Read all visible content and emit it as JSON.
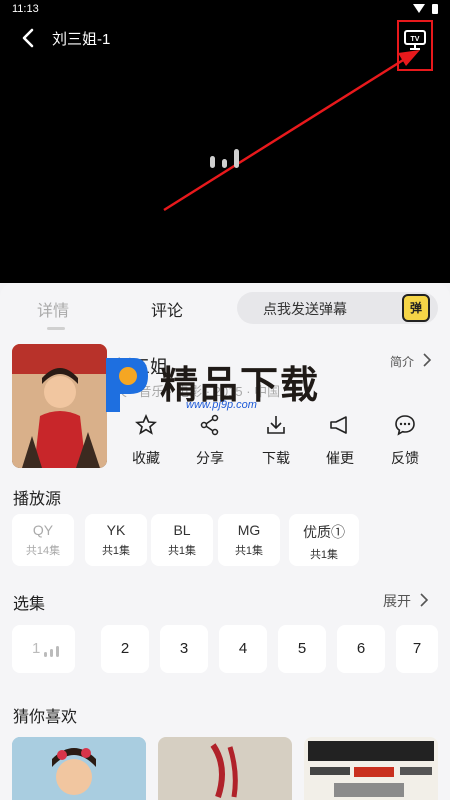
{
  "status_bar": {
    "time": "11:13"
  },
  "player": {
    "title": "刘三姐-1",
    "tv_icon_label": "TV"
  },
  "tabs": [
    {
      "label": "详情",
      "active": true
    },
    {
      "label": "评论",
      "active": false
    }
  ],
  "danmu": {
    "placeholder": "点我发送弹幕",
    "icon_label": "弹"
  },
  "show": {
    "name": "刘三姐",
    "meta": "天 · 音乐 · 电影 · 2015 · 中国",
    "intro_label": "简介"
  },
  "watermark": {
    "text": "精品下载",
    "url": "www.pj9p.com"
  },
  "actions": [
    {
      "label": "收藏",
      "icon": "star-icon"
    },
    {
      "label": "分享",
      "icon": "share-icon"
    },
    {
      "label": "下载",
      "icon": "download-icon"
    },
    {
      "label": "催更",
      "icon": "megaphone-icon"
    },
    {
      "label": "反馈",
      "icon": "feedback-icon"
    }
  ],
  "sources": {
    "title": "播放源",
    "items": [
      {
        "name": "QY",
        "count": "共14集",
        "active": true
      },
      {
        "name": "YK",
        "count": "共1集",
        "active": false
      },
      {
        "name": "BL",
        "count": "共1集",
        "active": false
      },
      {
        "name": "MG",
        "count": "共1集",
        "active": false
      },
      {
        "name": "优质①",
        "count": "共1集",
        "active": false
      }
    ]
  },
  "episodes": {
    "title": "选集",
    "expand_label": "展开",
    "items": [
      "1",
      "2",
      "3",
      "4",
      "5",
      "6",
      "7"
    ]
  },
  "recommend": {
    "title": "猜你喜欢"
  },
  "colors": {
    "highlight": "#e8191c",
    "arrow": "#e8191c",
    "page_bg": "#f5f5f7"
  }
}
